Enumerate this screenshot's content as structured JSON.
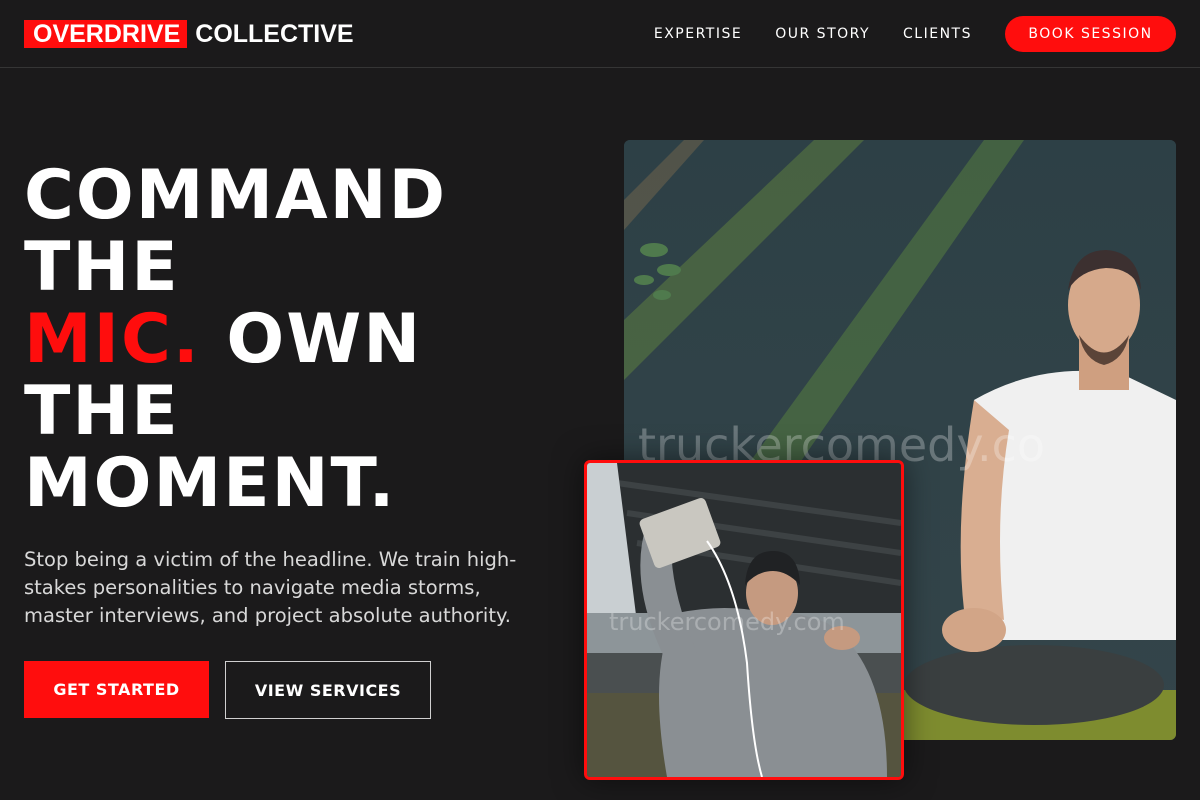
{
  "header": {
    "logo_box": "OVERDRIVE",
    "logo_text": "COLLECTIVE",
    "nav": [
      "EXPERTISE",
      "OUR STORY",
      "CLIENTS"
    ],
    "cta": "BOOK SESSION"
  },
  "hero": {
    "line1": "COMMAND",
    "line2": "THE",
    "line3_accent": "MIC.",
    "line3_rest": " OWN",
    "line4": "THE",
    "line5": "MOMENT.",
    "subtext": "Stop being a victim of the headline. We train high-stakes personalities to navigate media storms, master interviews, and project absolute authority.",
    "primary_button": "GET STARTED",
    "secondary_button": "VIEW SERVICES"
  },
  "images": {
    "main_watermark": "truckercomedy.co",
    "inset_watermark": "truckercomedy.com"
  },
  "colors": {
    "accent": "#ff0d0d",
    "background": "#1b1a1b"
  }
}
